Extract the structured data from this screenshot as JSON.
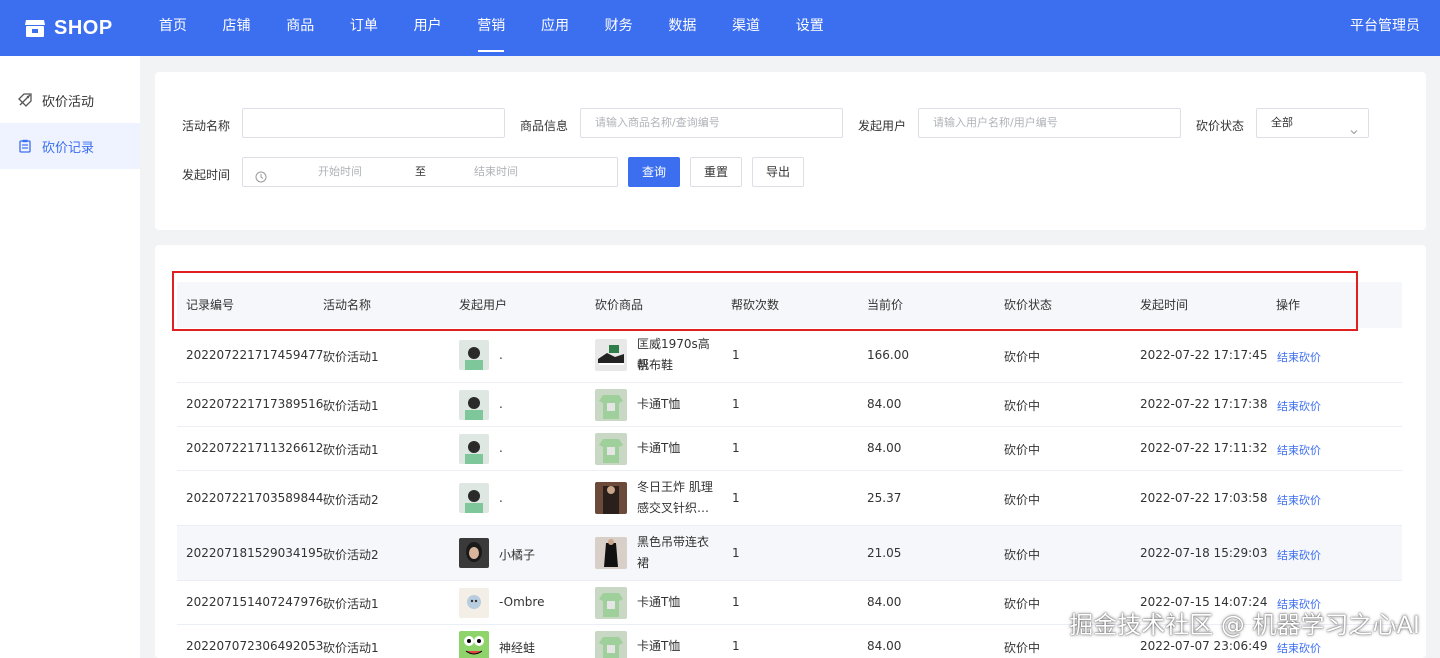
{
  "brand": {
    "name": "SHOP",
    "icon": "shop-icon"
  },
  "nav": [
    "首页",
    "店铺",
    "商品",
    "订单",
    "用户",
    "营销",
    "应用",
    "财务",
    "数据",
    "渠道",
    "设置"
  ],
  "nav_active": "营销",
  "user_label": "平台管理员",
  "sidebar": {
    "items": [
      {
        "label": "砍价活动",
        "icon": "tag-icon"
      },
      {
        "label": "砍价记录",
        "icon": "clipboard-icon"
      }
    ]
  },
  "filters": {
    "activity_name_label": "活动名称",
    "activity_name_value": "",
    "goods_label": "商品信息",
    "goods_placeholder": "请输入商品名称/查询编号",
    "user_label": "发起用户",
    "user_placeholder": "请输入用户名称/用户编号",
    "status_label": "砍价状态",
    "status_value": "全部",
    "time_label": "发起时间",
    "start_placeholder": "开始时间",
    "range_sep": "至",
    "end_placeholder": "结束时间",
    "query_button": "查询",
    "reset_button": "重置",
    "export_button": "导出"
  },
  "table": {
    "columns": [
      "记录编号",
      "活动名称",
      "发起用户",
      "砍价商品",
      "帮砍次数",
      "当前价",
      "砍价状态",
      "发起时间",
      "操作"
    ],
    "rows": [
      {
        "id": "202207221717459477",
        "activity": "砍价活动1",
        "user": ".",
        "product_l1": "匡威1970s高帮",
        "product_l2": "帆布鞋",
        "count": "1",
        "price": "166.00",
        "status": "砍价中",
        "time": "2022-07-22 17:17:45",
        "action": "结束砍价"
      },
      {
        "id": "202207221717389516",
        "activity": "砍价活动1",
        "user": ".",
        "product_l1": "卡通T恤",
        "product_l2": "",
        "count": "1",
        "price": "84.00",
        "status": "砍价中",
        "time": "2022-07-22 17:17:38",
        "action": "结束砍价"
      },
      {
        "id": "202207221711326612",
        "activity": "砍价活动1",
        "user": ".",
        "product_l1": "卡通T恤",
        "product_l2": "",
        "count": "1",
        "price": "84.00",
        "status": "砍价中",
        "time": "2022-07-22 17:11:32",
        "action": "结束砍价"
      },
      {
        "id": "202207221703589844",
        "activity": "砍价活动2",
        "user": ".",
        "product_l1": "冬日王炸 肌理",
        "product_l2": "感交叉针织…",
        "count": "1",
        "price": "25.37",
        "status": "砍价中",
        "time": "2022-07-22 17:03:58",
        "action": "结束砍价"
      },
      {
        "id": "202207181529034195",
        "activity": "砍价活动2",
        "user": "小橘子",
        "product_l1": "黑色吊带连衣",
        "product_l2": "裙",
        "count": "1",
        "price": "21.05",
        "status": "砍价中",
        "time": "2022-07-18 15:29:03",
        "action": "结束砍价"
      },
      {
        "id": "202207151407247976",
        "activity": "砍价活动1",
        "user": "-Ombre",
        "product_l1": "卡通T恤",
        "product_l2": "",
        "count": "1",
        "price": "84.00",
        "status": "砍价中",
        "time": "2022-07-15 14:07:24",
        "action": "结束砍价"
      },
      {
        "id": "202207072306492053",
        "activity": "砍价活动1",
        "user": "神经蛙",
        "product_l1": "卡通T恤",
        "product_l2": "",
        "count": "1",
        "price": "84.00",
        "status": "砍价中",
        "time": "2022-07-07 23:06:49",
        "action": "结束砍价"
      }
    ]
  },
  "watermark": "掘金技术社区 @ 机器学习之心AI",
  "colors": {
    "primary": "#3c6ef0",
    "highlight": "#e02020"
  }
}
